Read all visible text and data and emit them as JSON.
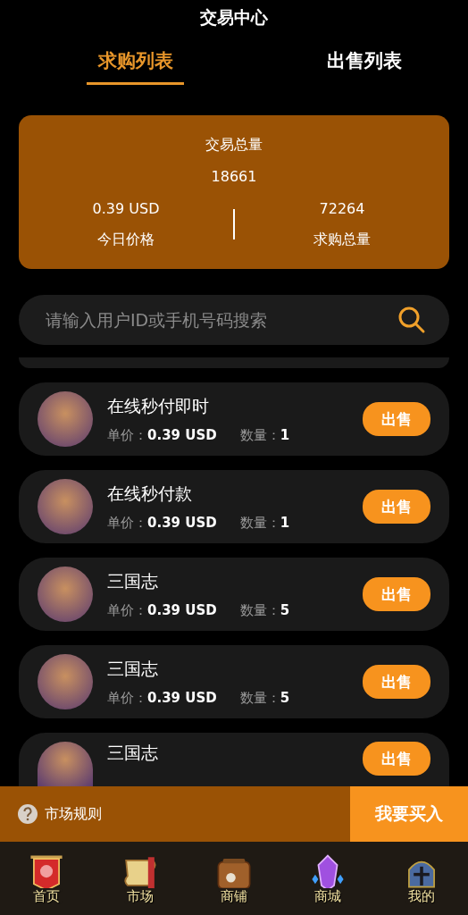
{
  "header": {
    "title": "交易中心"
  },
  "tabs": [
    {
      "label": "求购列表",
      "selected": true
    },
    {
      "label": "出售列表",
      "selected": false
    }
  ],
  "summary": {
    "total_label": "交易总量",
    "total_value": "18661",
    "price_value": "0.39 USD",
    "price_label": "今日价格",
    "demand_value": "72264",
    "demand_label": "求购总量"
  },
  "search": {
    "placeholder": "请输入用户ID或手机号码搜索"
  },
  "orders": [
    {
      "kind": "full",
      "name": "在线秒付即时",
      "price_label": "单价：",
      "price": "0.39 USD",
      "qty_label": "数量：",
      "qty": "1",
      "action": "出售"
    },
    {
      "kind": "full",
      "name": "在线秒付款",
      "price_label": "单价：",
      "price": "0.39 USD",
      "qty_label": "数量：",
      "qty": "1",
      "action": "出售"
    },
    {
      "kind": "full",
      "name": "三国志",
      "price_label": "单价：",
      "price": "0.39 USD",
      "qty_label": "数量：",
      "qty": "5",
      "action": "出售"
    },
    {
      "kind": "full",
      "name": "三国志",
      "price_label": "单价：",
      "price": "0.39 USD",
      "qty_label": "数量：",
      "qty": "5",
      "action": "出售"
    },
    {
      "kind": "partial",
      "name": "三国志",
      "action": "出售"
    }
  ],
  "action_bar": {
    "rules": "市场规则",
    "buy": "我要买入"
  },
  "nav": [
    {
      "label": "首页",
      "kind": "banner"
    },
    {
      "label": "市场",
      "kind": "scroll"
    },
    {
      "label": "商铺",
      "kind": "chest"
    },
    {
      "label": "商城",
      "kind": "gem"
    },
    {
      "label": "我的",
      "kind": "helmet"
    }
  ]
}
